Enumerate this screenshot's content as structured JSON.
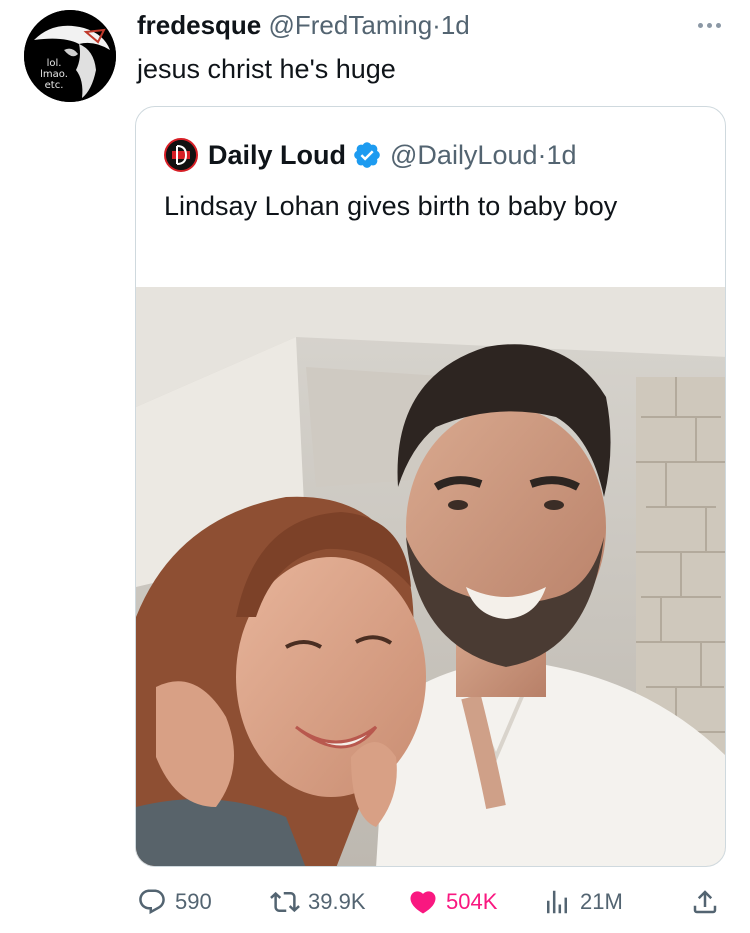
{
  "author": {
    "display_name": "fredesque",
    "handle": "@FredTaming",
    "separator": "·",
    "time": "1d",
    "avatar_text": [
      "lol.",
      "lmao.",
      "etc."
    ]
  },
  "tweet": {
    "text": "jesus christ he's huge"
  },
  "quoted": {
    "display_name": "Daily Loud",
    "handle": "@DailyLoud",
    "separator": "·",
    "time": "1d",
    "verified_color": "#1d9bf0",
    "text": "Lindsay Lohan gives birth to baby boy"
  },
  "actions": {
    "replies": "590",
    "retweets": "39.9K",
    "likes": "504K",
    "views": "21M",
    "like_color": "#f91880"
  }
}
